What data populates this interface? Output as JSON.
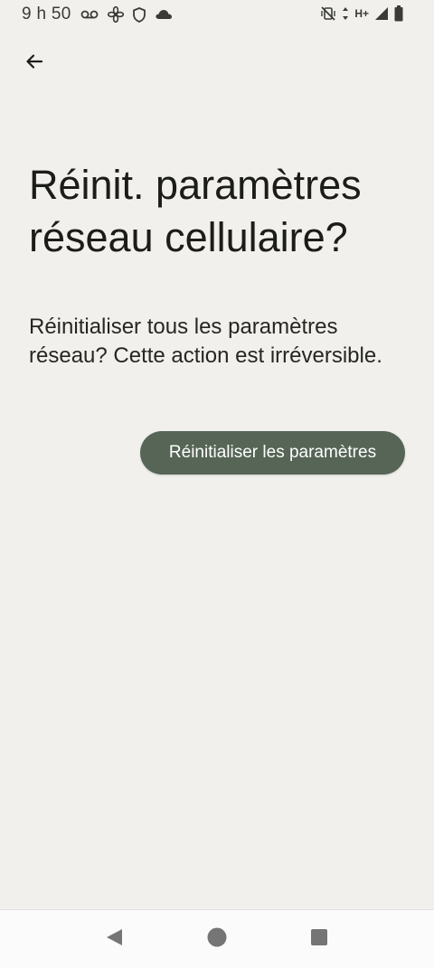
{
  "status_bar": {
    "time": "9 h 50",
    "network": "H+",
    "left_icons": [
      "voicemail-icon",
      "fan-icon",
      "shield-icon",
      "cloud-icon"
    ],
    "right_icons": [
      "vibrate-off-icon",
      "data-arrows-icon",
      "signal-icon",
      "battery-icon"
    ]
  },
  "header": {
    "back_icon": "arrow-left-icon"
  },
  "main": {
    "title": "Réinit. paramètres réseau cellulaire?",
    "description": "Réinitialiser tous les paramètres réseau? Cette action est irréversible.",
    "reset_button_label": "Réinitialiser les paramètres"
  },
  "colors": {
    "background": "#f1f0ec",
    "button_bg": "#566556",
    "button_text": "#ffffff",
    "nav_bar_bg": "#fbfbfb"
  },
  "nav_bar": {
    "icons": [
      "back-triangle-icon",
      "home-circle-icon",
      "recents-square-icon"
    ]
  }
}
